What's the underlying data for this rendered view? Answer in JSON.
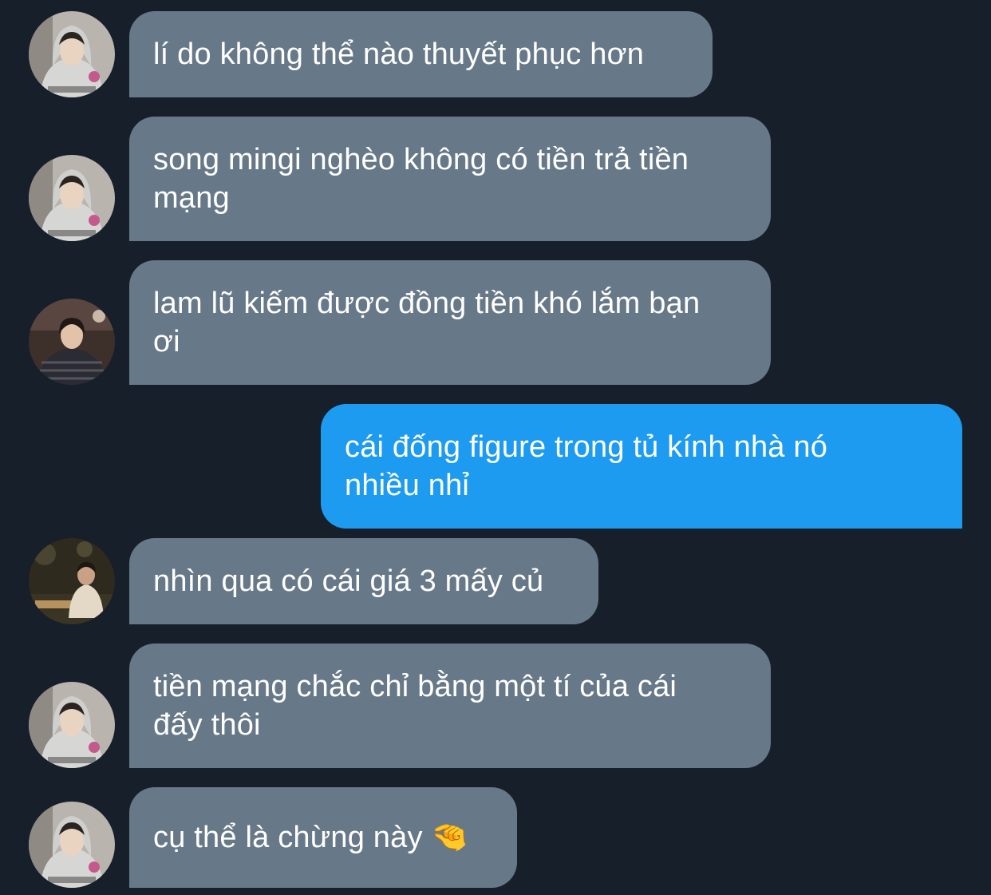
{
  "messages": [
    {
      "direction": "in",
      "avatar": "hoodie-person-avatar",
      "text": "lí do không thể nào thuyết phục hơn"
    },
    {
      "direction": "in",
      "avatar": "hoodie-person-avatar",
      "text": "song mingi nghèo không có tiền trả tiền\nmạng"
    },
    {
      "direction": "in",
      "avatar": "striped-sweater-person-avatar",
      "text": "lam lũ kiếm được đồng tiền khó lắm bạn\nơi"
    },
    {
      "direction": "out",
      "avatar": "",
      "text": "cái đống figure trong tủ kính nhà nó\nnhiều nhỉ"
    },
    {
      "direction": "in",
      "avatar": "seated-person-avatar",
      "text": "nhìn qua có cái giá 3 mấy củ"
    },
    {
      "direction": "in",
      "avatar": "hoodie-person-avatar",
      "text": "tiền mạng chắc chỉ bằng một tí của cái\nđấy thôi"
    },
    {
      "direction": "in",
      "avatar": "hoodie-person-avatar",
      "text": "cụ thể là chừng này 🤏"
    }
  ],
  "colors": {
    "background": "#161f2a",
    "incoming_bubble": "#677888",
    "outgoing_bubble": "#1d9bf0",
    "text": "#ffffff"
  }
}
